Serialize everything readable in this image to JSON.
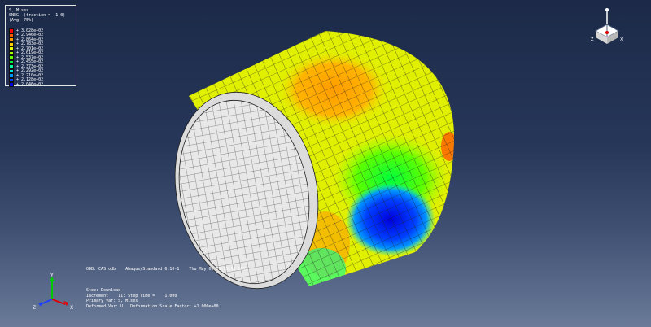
{
  "legend": {
    "title_lines": [
      "S, Mises",
      "SNEG, (fraction = -1.0)",
      "(Avg: 75%)"
    ],
    "entries": [
      {
        "label": "+ 3.028e+02",
        "color": "#ff0000"
      },
      {
        "label": "+ 2.946e+02",
        "color": "#ff5a00"
      },
      {
        "label": "+ 2.864e+02",
        "color": "#ff9c00"
      },
      {
        "label": "+ 2.783e+02",
        "color": "#ffd200"
      },
      {
        "label": "+ 2.701e+02",
        "color": "#e6ff00"
      },
      {
        "label": "+ 2.619e+02",
        "color": "#a8ff00"
      },
      {
        "label": "+ 2.537e+02",
        "color": "#5eff00"
      },
      {
        "label": "+ 2.455e+02",
        "color": "#00ff3c"
      },
      {
        "label": "+ 2.373e+02",
        "color": "#00ff9c"
      },
      {
        "label": "+ 2.292e+02",
        "color": "#00e6e6"
      },
      {
        "label": "+ 2.210e+02",
        "color": "#0096ff"
      },
      {
        "label": "+ 2.128e+02",
        "color": "#0040ff"
      },
      {
        "label": "+ 2.046e+02",
        "color": "#0000dc"
      }
    ]
  },
  "info": {
    "odb_line": "ODB: CAS.odb    Abaqus/Standard 6.10-1    Thu May 09 11:31:52 2013",
    "step_line": "Step: Download",
    "increment_line": "Increment    11: Step Time =    1.000",
    "primary_line": "Primary Var: S, Mises",
    "deformed_line": "Deformed Var: U   Deformation Scale Factor: +1.000e+00"
  },
  "triad": {
    "x_label": "X",
    "y_label": "Y",
    "z_label": "Z"
  },
  "colors": {
    "model_yellow": "#e0f000",
    "model_orange": "#ff9c00",
    "model_blue": "#0000dc",
    "inner_surface": "#e8e8e8",
    "mesh_line": "#202020"
  }
}
